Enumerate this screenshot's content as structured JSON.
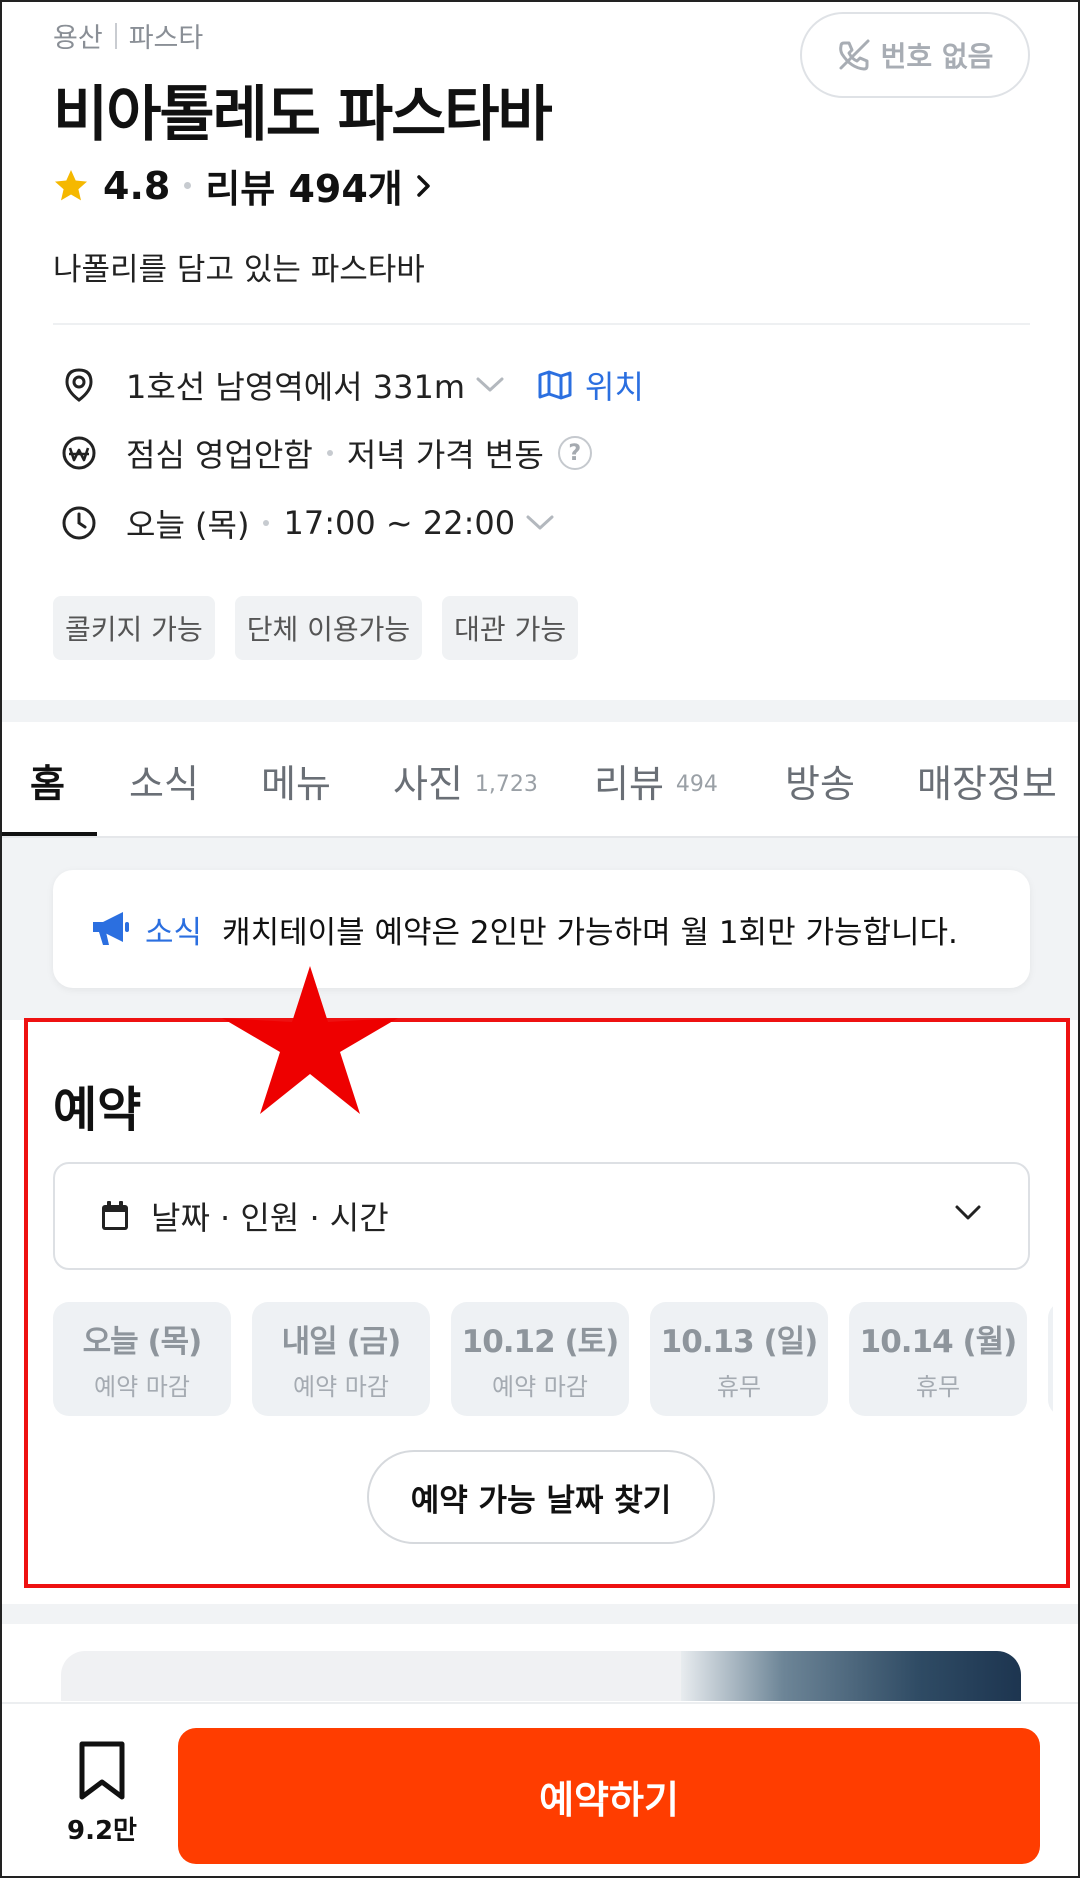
{
  "breadcrumb": {
    "area": "용산",
    "category": "파스타"
  },
  "phone_button": {
    "label": "번호 없음",
    "icon": "phone-off-icon"
  },
  "store": {
    "name": "비아톨레도 파스타바",
    "rating": "4.8",
    "reviews": "리뷰 494개",
    "tagline": "나폴리를 담고 있는 파스타바"
  },
  "info": {
    "distance": "1호선 남영역에서 331m",
    "location_link": "위치",
    "lunch": "점심 영업안함",
    "dinner_price": "저녁 가격 변동",
    "help": "?",
    "hours_day": "오늘 (목)",
    "hours_time": "17:00 ~ 22:00"
  },
  "tags": [
    "콜키지 가능",
    "단체 이용가능",
    "대관 가능"
  ],
  "tabs": [
    {
      "label": "홈",
      "count": ""
    },
    {
      "label": "소식",
      "count": ""
    },
    {
      "label": "메뉴",
      "count": ""
    },
    {
      "label": "사진",
      "count": "1,723"
    },
    {
      "label": "리뷰",
      "count": "494"
    },
    {
      "label": "방송",
      "count": ""
    },
    {
      "label": "매장정보",
      "count": ""
    }
  ],
  "notice": {
    "label": "소식",
    "text": "캐치테이블 예약은 2인만 가능하며 월 1회만 가능합니다."
  },
  "reservation": {
    "title": "예약",
    "dropdown_label": "날짜 · 인원 · 시간",
    "dates": [
      {
        "date": "오늘 (목)",
        "status": "예약 마감"
      },
      {
        "date": "내일 (금)",
        "status": "예약 마감"
      },
      {
        "date": "10.12 (토)",
        "status": "예약 마감"
      },
      {
        "date": "10.13 (일)",
        "status": "휴무"
      },
      {
        "date": "10.14 (월)",
        "status": "휴무"
      }
    ],
    "find_button": "예약 가능 날짜 찾기"
  },
  "bottom": {
    "bookmark_count": "9.2만",
    "reserve_button": "예약하기"
  },
  "colors": {
    "accent_orange": "#ff3d00",
    "link_blue": "#2b6fe0",
    "star_yellow": "#f5b800",
    "highlight_red": "#e11111"
  }
}
